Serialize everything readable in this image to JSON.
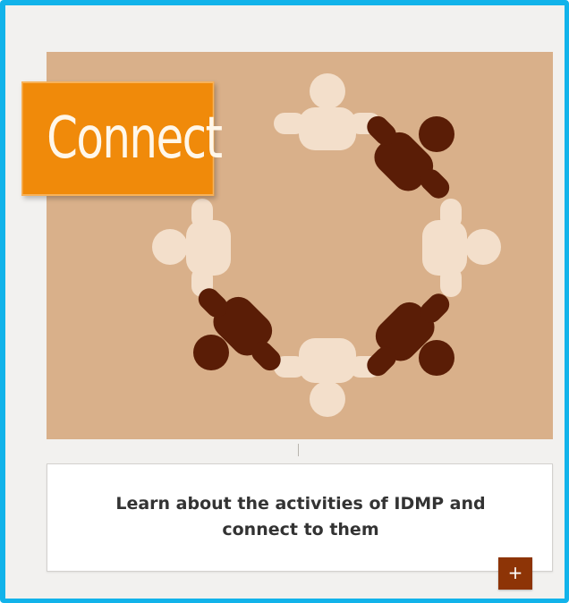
{
  "card": {
    "badge_label": "Connect",
    "description": "Learn about the activities of IDMP and connect to them",
    "expand_button_label": "+",
    "image": {
      "icon": "people-circle-illustration",
      "background_color": "#d9b08a",
      "light_figure_color": "#f3dfcb",
      "dark_figure_color": "#5a1d06"
    }
  },
  "colors": {
    "frame_border": "#12b3ea",
    "badge_background": "#f08a0a",
    "button_background": "#8d3406"
  }
}
